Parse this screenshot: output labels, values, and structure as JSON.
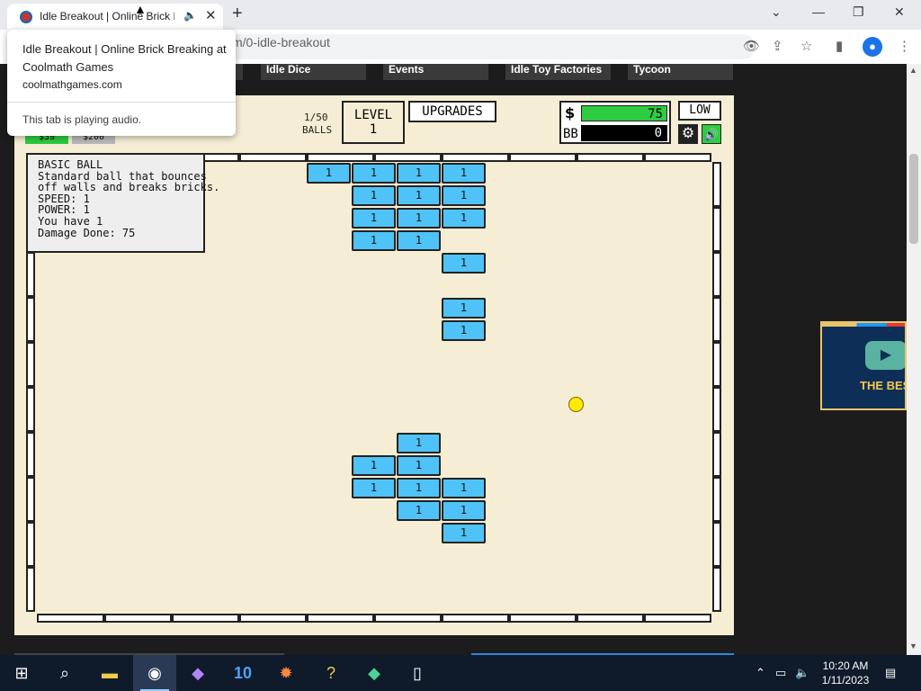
{
  "browser": {
    "tab_title": "Idle Breakout | Online Brick Breaking at Coolmath Games",
    "new_tab_label": "+",
    "url_suffix": "m/0-idle-breakout",
    "hover_card": {
      "title": "Idle Breakout | Online Brick Breaking at Coolmath Games",
      "domain": "coolmathgames.com",
      "audio_status": "This tab is playing audio."
    },
    "window_controls": {
      "minimize": "—",
      "restore": "❐",
      "close": "✕",
      "tab_list": "⌄"
    }
  },
  "site_nav": [
    "Idle Dice",
    "Events",
    "Idle Toy Factories",
    "Tycoon"
  ],
  "game": {
    "ball_prices": [
      "$39",
      "$200"
    ],
    "balls_count": "1/50",
    "balls_label": "BALLS",
    "level_label": "LEVEL",
    "level_value": "1",
    "upgrades_label": "UPGRADES",
    "money_symbol": "$",
    "money": "75",
    "bb_label": "BB",
    "bb_value": "0",
    "quality": "LOW",
    "ball_info": {
      "name": "BASIC BALL",
      "description_line1": "Standard ball that bounces",
      "description_line2": "off walls and breaks bricks.",
      "speed": "SPEED: 1",
      "power": "POWER: 1",
      "owned": "You have 1",
      "damage": "Damage Done: 75"
    },
    "bricks": [
      {
        "col": 0,
        "row": 0,
        "hp": "1"
      },
      {
        "col": 1,
        "row": 0,
        "hp": "1"
      },
      {
        "col": 2,
        "row": 0,
        "hp": "1"
      },
      {
        "col": 3,
        "row": 0,
        "hp": "1"
      },
      {
        "col": 1,
        "row": 1,
        "hp": "1"
      },
      {
        "col": 2,
        "row": 1,
        "hp": "1"
      },
      {
        "col": 3,
        "row": 1,
        "hp": "1"
      },
      {
        "col": 1,
        "row": 2,
        "hp": "1"
      },
      {
        "col": 2,
        "row": 2,
        "hp": "1"
      },
      {
        "col": 3,
        "row": 2,
        "hp": "1"
      },
      {
        "col": 1,
        "row": 3,
        "hp": "1"
      },
      {
        "col": 2,
        "row": 3,
        "hp": "1"
      },
      {
        "col": 3,
        "row": 4,
        "hp": "1"
      },
      {
        "col": 3,
        "row": 6,
        "hp": "1"
      },
      {
        "col": 3,
        "row": 7,
        "hp": "1"
      },
      {
        "col": 2,
        "row": 12,
        "hp": "1"
      },
      {
        "col": 1,
        "row": 13,
        "hp": "1"
      },
      {
        "col": 2,
        "row": 13,
        "hp": "1"
      },
      {
        "col": 1,
        "row": 14,
        "hp": "1"
      },
      {
        "col": 2,
        "row": 14,
        "hp": "1"
      },
      {
        "col": 3,
        "row": 14,
        "hp": "1"
      },
      {
        "col": 2,
        "row": 15,
        "hp": "1"
      },
      {
        "col": 3,
        "row": 15,
        "hp": "1"
      },
      {
        "col": 3,
        "row": 16,
        "hp": "1"
      }
    ]
  },
  "ad": {
    "text": "THE BES"
  },
  "taskbar": {
    "time": "10:20 AM",
    "date": "1/11/2023"
  },
  "colors": {
    "brick": "#4fc3f7",
    "game_bg": "#f5eed5",
    "money_bar": "#2ecc40",
    "ball": "#ffeb00"
  }
}
